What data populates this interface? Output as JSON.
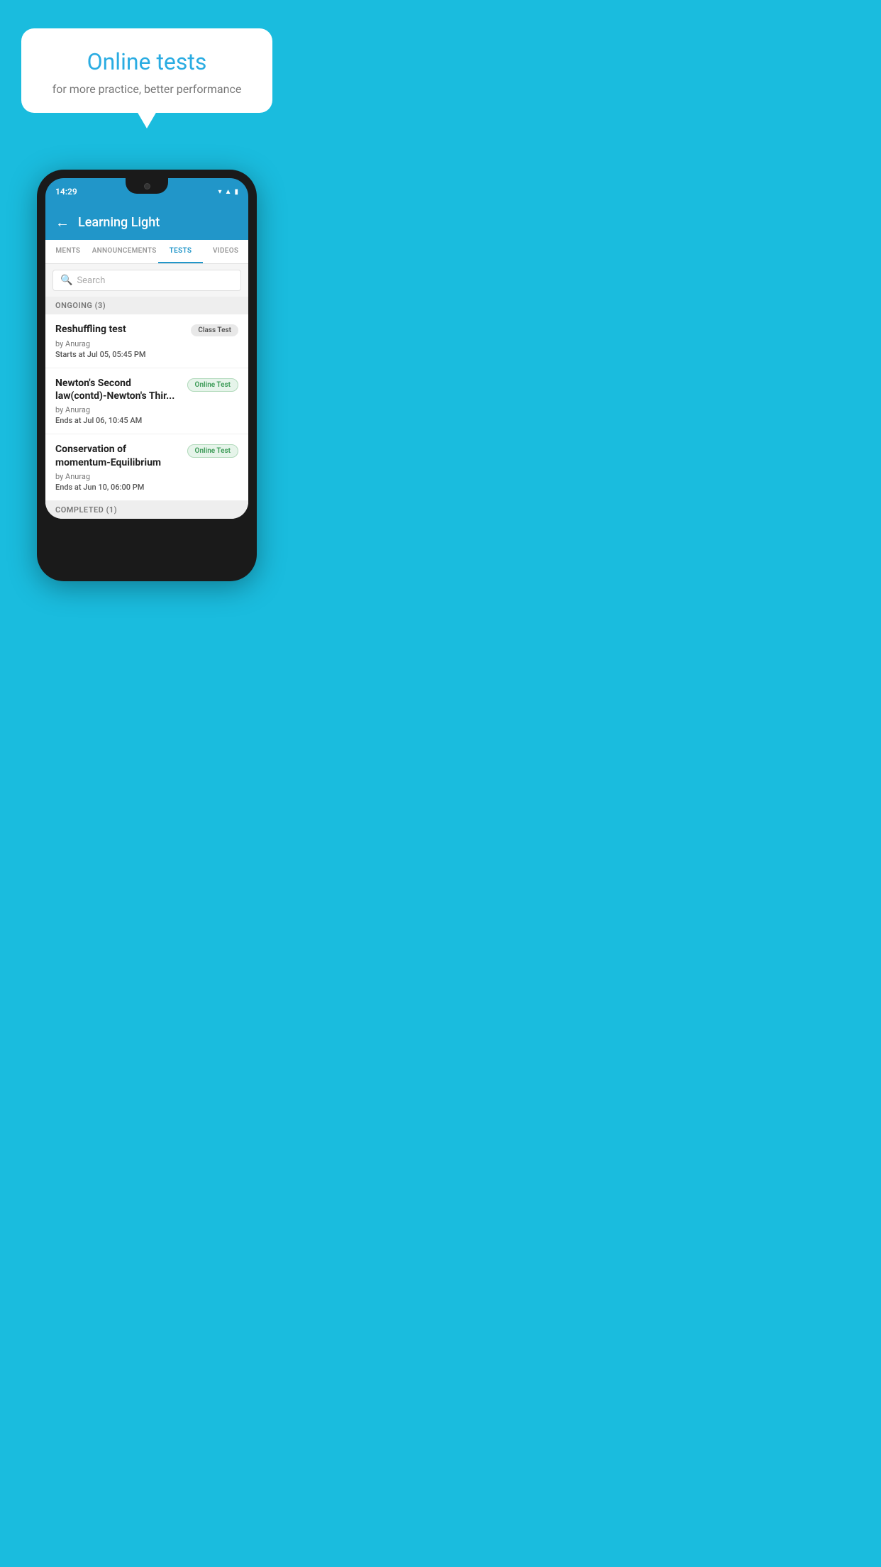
{
  "background_color": "#1ABCDE",
  "speech_bubble": {
    "title": "Online tests",
    "subtitle": "for more practice, better performance"
  },
  "phone": {
    "time": "14:29",
    "status_icons": [
      "wifi",
      "signal",
      "battery"
    ],
    "header": {
      "back_label": "←",
      "title": "Learning Light"
    },
    "tabs": [
      {
        "label": "MENTS",
        "active": false
      },
      {
        "label": "ANNOUNCEMENTS",
        "active": false
      },
      {
        "label": "TESTS",
        "active": true
      },
      {
        "label": "VIDEOS",
        "active": false
      }
    ],
    "search": {
      "placeholder": "Search"
    },
    "ongoing_section": {
      "header": "ONGOING (3)",
      "items": [
        {
          "name": "Reshuffling test",
          "badge": "Class Test",
          "badge_type": "class",
          "by": "by Anurag",
          "date_label": "Starts at",
          "date_value": "Jul 05, 05:45 PM"
        },
        {
          "name": "Newton's Second law(contd)-Newton's Thir...",
          "badge": "Online Test",
          "badge_type": "online",
          "by": "by Anurag",
          "date_label": "Ends at",
          "date_value": "Jul 06, 10:45 AM"
        },
        {
          "name": "Conservation of momentum-Equilibrium",
          "badge": "Online Test",
          "badge_type": "online",
          "by": "by Anurag",
          "date_label": "Ends at",
          "date_value": "Jun 10, 06:00 PM"
        }
      ]
    },
    "completed_section": {
      "header": "COMPLETED (1)"
    }
  }
}
